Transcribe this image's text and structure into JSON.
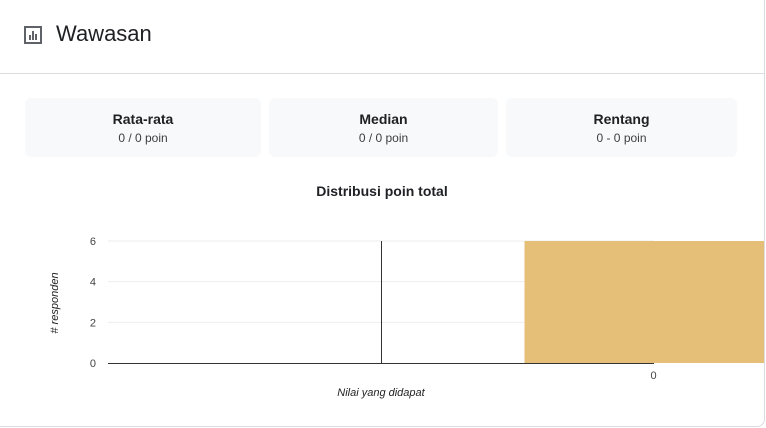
{
  "header": {
    "title": "Wawasan",
    "icon": "bar-chart-icon"
  },
  "stats": [
    {
      "label": "Rata-rata",
      "value": "0 / 0 poin"
    },
    {
      "label": "Median",
      "value": "0 / 0 poin"
    },
    {
      "label": "Rentang",
      "value": "0 - 0 poin"
    }
  ],
  "chart_data": {
    "type": "bar",
    "title": "Distribusi poin total",
    "xlabel": "Nilai yang didapat",
    "ylabel": "# responden",
    "categories": [
      "0"
    ],
    "values": [
      6
    ],
    "ylim": [
      0,
      6
    ],
    "yticks": [
      0,
      2,
      4,
      6
    ],
    "bar_color": "#e5be78",
    "grid": true
  }
}
